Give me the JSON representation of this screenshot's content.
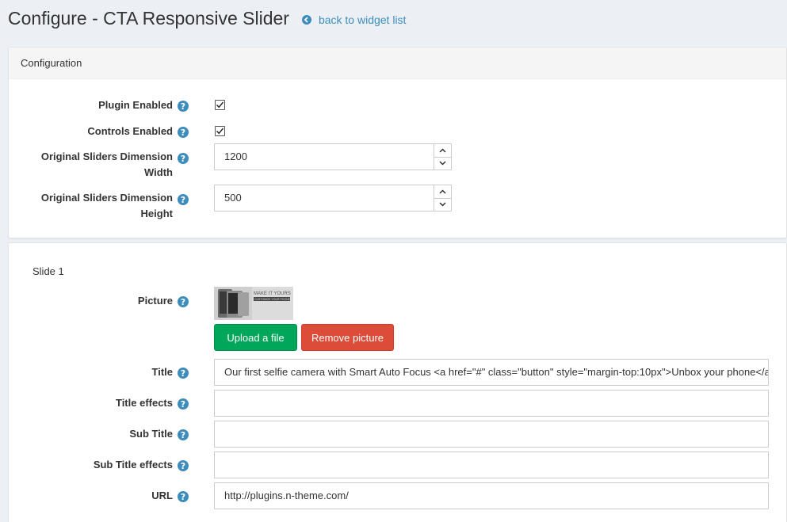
{
  "page": {
    "title": "Configure - CTA Responsive Slider",
    "back_link": "back to widget list"
  },
  "config": {
    "heading": "Configuration",
    "plugin_enabled": {
      "label": "Plugin Enabled",
      "checked": true
    },
    "controls_enabled": {
      "label": "Controls Enabled",
      "checked": true
    },
    "width": {
      "label_line1": "Original Sliders Dimension",
      "label_line2": "Width",
      "value": "1200"
    },
    "height": {
      "label_line1": "Original Sliders Dimension",
      "label_line2": "Height",
      "value": "500"
    }
  },
  "slide": {
    "heading": "Slide 1",
    "picture": {
      "label": "Picture",
      "thumb_text_line1": "MAKE IT YOURS",
      "thumb_text_line2": "CUSTOMIZE YOUR PHONE"
    },
    "upload_button": "Upload a file",
    "remove_button": "Remove picture",
    "title": {
      "label": "Title",
      "value": "Our first selfie camera with Smart Auto Focus <a href=\"#\" class=\"button\" style=\"margin-top:10px\">Unbox your phone</a>"
    },
    "title_effects": {
      "label": "Title effects",
      "value": ""
    },
    "sub_title": {
      "label": "Sub Title",
      "value": ""
    },
    "sub_title_effects": {
      "label": "Sub Title effects",
      "value": ""
    },
    "url": {
      "label": "URL",
      "value": "http://plugins.n-theme.com/"
    }
  },
  "colors": {
    "link": "#3c8dbc",
    "upload_button": "#00a65a",
    "remove_button": "#dd4b39",
    "background": "#ecf0f5"
  }
}
